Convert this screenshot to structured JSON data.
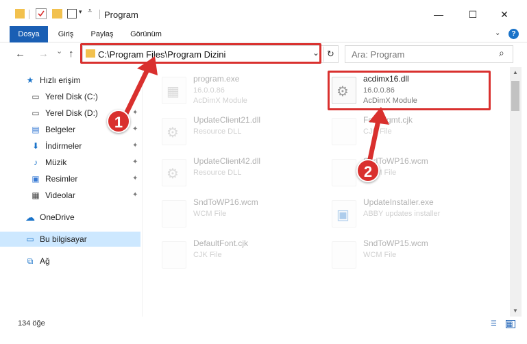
{
  "window": {
    "title": "Program",
    "min_glyph": "—",
    "max_glyph": "☐",
    "close_glyph": "✕"
  },
  "ribbon": {
    "tabs": [
      "Dosya",
      "Giriş",
      "Paylaş",
      "Görünüm"
    ],
    "help": "?"
  },
  "nav": {
    "back": "←",
    "forward": "→",
    "up": "↑",
    "dropdown": "⌄",
    "recent": "⌄",
    "refresh": "↻"
  },
  "address": {
    "path": "C:\\Program Files\\Program Dizini"
  },
  "search": {
    "placeholder": "Ara: Program",
    "icon": "⌕"
  },
  "sidebar": {
    "quick_access": "Hızlı erişim",
    "items": [
      {
        "label": "Yerel Disk (C:)",
        "icon": "▭"
      },
      {
        "label": "Yerel Disk (D:)",
        "icon": "▭"
      },
      {
        "label": "Belgeler",
        "icon": "▤"
      },
      {
        "label": "İndirmeler",
        "icon": "⬇"
      },
      {
        "label": "Müzik",
        "icon": "♪"
      },
      {
        "label": "Resimler",
        "icon": "▣"
      },
      {
        "label": "Videolar",
        "icon": "▦"
      }
    ],
    "onedrive": "OneDrive",
    "this_pc": "Bu bilgisayar",
    "network": "Ağ",
    "pin": "📌"
  },
  "files": {
    "left": [
      {
        "name": "program.exe",
        "l2": "16.0.0.86",
        "l3": "AcDimX Module"
      },
      {
        "name": "UpdateClient21.dll",
        "l2": "Resource DLL",
        "l3": ""
      },
      {
        "name": "UpdateClient42.dll",
        "l2": "Resource DLL",
        "l3": ""
      },
      {
        "name": "SndToWP16.wcm",
        "l2": "WCM File",
        "l3": ""
      },
      {
        "name": "DefaultFont.cjk",
        "l2": "CJK File",
        "l3": ""
      }
    ],
    "right": [
      {
        "name": "acdimx16.dll",
        "l2": "16.0.0.86",
        "l3": "AcDimX Module"
      },
      {
        "name": "FontMgmt.cjk",
        "l2": "CJK File",
        "l3": ""
      },
      {
        "name": "SndToWP16.wcm",
        "l2": "WCM File",
        "l3": ""
      },
      {
        "name": "UpdateInstaller.exe",
        "l2": "ABBY updates installer",
        "l3": ""
      },
      {
        "name": "SndToWP15.wcm",
        "l2": "WCM File",
        "l3": ""
      }
    ]
  },
  "annotations": {
    "badge1": "1",
    "badge2": "2",
    "color": "#d9302e"
  },
  "status": {
    "count": "134 öğe"
  }
}
